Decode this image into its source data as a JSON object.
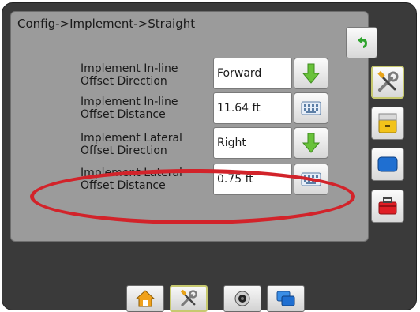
{
  "header": {
    "breadcrumb": "Config->Implement->Straight"
  },
  "rows": [
    {
      "label_line1": "Implement In-line",
      "label_line2": "Offset Direction",
      "value": "Forward",
      "action_icon": "green-down-arrow-icon"
    },
    {
      "label_line1": "Implement In-line",
      "label_line2": "Offset Distance",
      "value": "11.64 ft",
      "action_icon": "keyboard-icon"
    },
    {
      "label_line1": "Implement Lateral",
      "label_line2": "Offset Direction",
      "value": "Right",
      "action_icon": "green-down-arrow-icon"
    },
    {
      "label_line1": "Implement Lateral",
      "label_line2": "Offset Distance",
      "value": "0.75 ft",
      "action_icon": "keyboard-icon"
    }
  ],
  "side_icons": [
    "tools-icon",
    "filing-cabinet-icon",
    "blue-screen-icon",
    "red-toolbox-icon"
  ],
  "bottom_tabs": [
    "home-icon",
    "tools-icon",
    "camera-icon",
    "blue-windows-icon"
  ],
  "colors": {
    "panel": "#9b9b9b",
    "frame": "#3a3a3a",
    "highlight": "#d2232a",
    "accent_green": "#69c23a"
  }
}
